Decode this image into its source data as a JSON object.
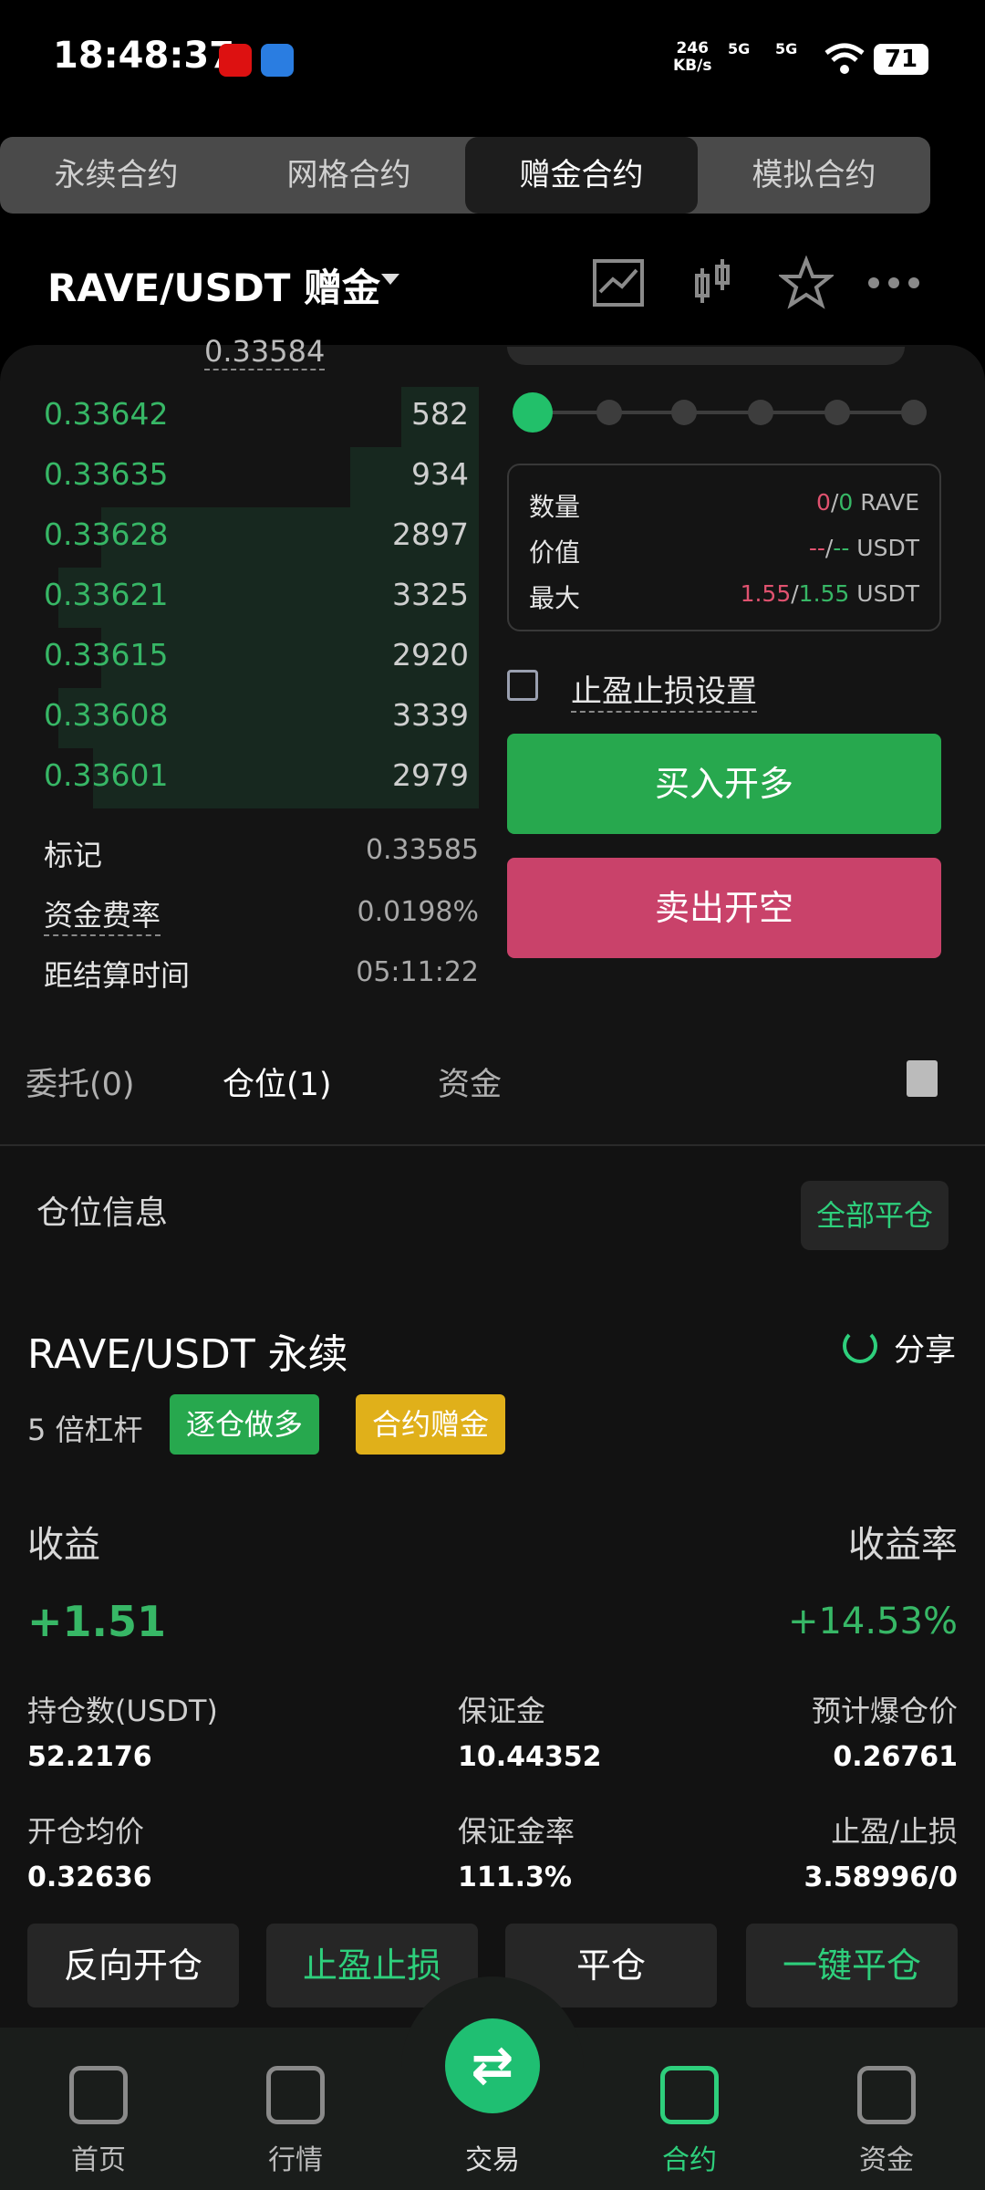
{
  "status_bar": {
    "time": "18:48:37",
    "speed": "246",
    "speed_unit": "KB/s",
    "net1": "5G",
    "net2": "5G",
    "battery": "71"
  },
  "top_tabs": [
    "永续合约",
    "网格合约",
    "赠金合约",
    "模拟合约"
  ],
  "pair": {
    "title": "RAVE/USDT  赠金"
  },
  "orderbook": {
    "top_price": "0.33584",
    "rows": [
      {
        "price": "0.33642",
        "qty": "582",
        "depth": 0.18
      },
      {
        "price": "0.33635",
        "qty": "934",
        "depth": 0.3
      },
      {
        "price": "0.33628",
        "qty": "2897",
        "depth": 0.88
      },
      {
        "price": "0.33621",
        "qty": "3325",
        "depth": 0.98
      },
      {
        "price": "0.33615",
        "qty": "2920",
        "depth": 0.88
      },
      {
        "price": "0.33608",
        "qty": "3339",
        "depth": 0.98
      },
      {
        "price": "0.33601",
        "qty": "2979",
        "depth": 0.9
      }
    ],
    "mark_label": "标记",
    "mark_value": "0.33585",
    "funding_label": "资金费率",
    "funding_value": "0.0198%",
    "settle_label": "距结算时间",
    "settle_value": "05:11:22"
  },
  "order_form": {
    "qty_label": "数量",
    "qty_a": "0",
    "qty_b": "0",
    "qty_unit": "RAVE",
    "value_label": "价值",
    "value_a": "--",
    "value_b": "--",
    "value_unit": "USDT",
    "max_label": "最大",
    "max_a": "1.55",
    "max_b": "1.55",
    "max_unit": "USDT",
    "tpsl_label": "止盈止损设置",
    "buy_label": "买入开多",
    "sell_label": "卖出开空"
  },
  "order_tabs": [
    "委托(0)",
    "仓位(1)",
    "资金"
  ],
  "position": {
    "header": "仓位信息",
    "close_all": "全部平仓",
    "title": "RAVE/USDT 永续",
    "share": "分享",
    "leverage": "5 倍杠杆",
    "badge1": "逐仓做多",
    "badge2": "合约赠金",
    "pnl_label": "收益",
    "roe_label": "收益率",
    "pnl_value": "+1.51",
    "roe_value": "+14.53%",
    "size_label": "持仓数(USDT)",
    "size_value": "52.2176",
    "margin_label": "保证金",
    "margin_value": "10.44352",
    "liq_label": "预计爆仓价",
    "liq_value": "0.26761",
    "entry_label": "开仓均价",
    "entry_value": "0.32636",
    "mratio_label": "保证金率",
    "mratio_value": "111.3%",
    "tpsl_label": "止盈/止损",
    "tpsl_value": "3.58996/0",
    "buttons": [
      "反向开仓",
      "止盈止损",
      "平仓",
      "一键平仓"
    ]
  },
  "nav": [
    "首页",
    "行情",
    "交易",
    "合约",
    "资金"
  ],
  "colors": {
    "green": "#37b766",
    "red": "#c9426a",
    "accent": "#2ecf7c",
    "badge_yellow": "#e0b01a"
  }
}
